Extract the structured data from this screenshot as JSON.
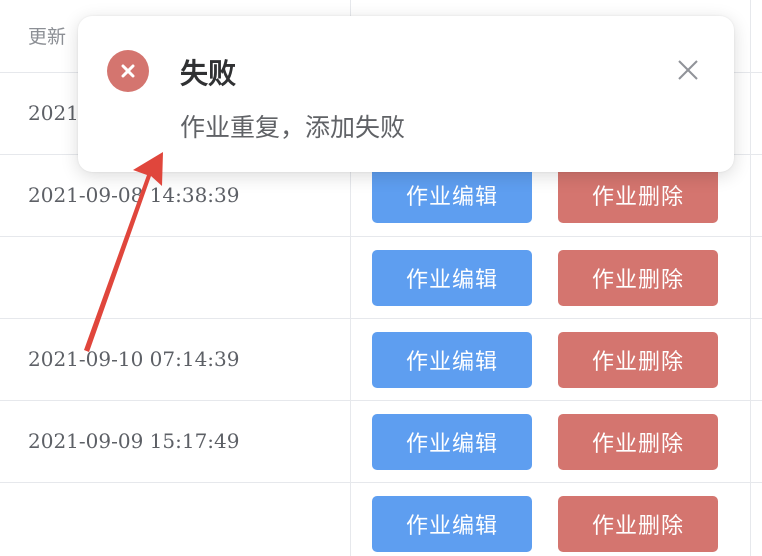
{
  "table": {
    "header_updated": "更新",
    "rows": [
      {
        "date": "2021",
        "edit_label": "",
        "delete_label": ""
      },
      {
        "date": "2021-09-08 14:38:39",
        "edit_label": "作业编辑",
        "delete_label": "作业删除"
      },
      {
        "date": "",
        "edit_label": "作业编辑",
        "delete_label": "作业删除"
      },
      {
        "date": "2021-09-10 07:14:39",
        "edit_label": "作业编辑",
        "delete_label": "作业删除"
      },
      {
        "date": "2021-09-09 15:17:49",
        "edit_label": "作业编辑",
        "delete_label": "作业删除"
      },
      {
        "date": "",
        "edit_label": "作业编辑",
        "delete_label": "作业删除"
      }
    ]
  },
  "notification": {
    "icon": "error-circle-icon",
    "title": "失败",
    "message": "作业重复，添加失败",
    "close_icon": "close-icon"
  },
  "colors": {
    "edit_button": "#5e9ef0",
    "delete_button": "#d4756f",
    "error_icon": "#d4756f",
    "annotation_arrow": "#e0463c"
  }
}
